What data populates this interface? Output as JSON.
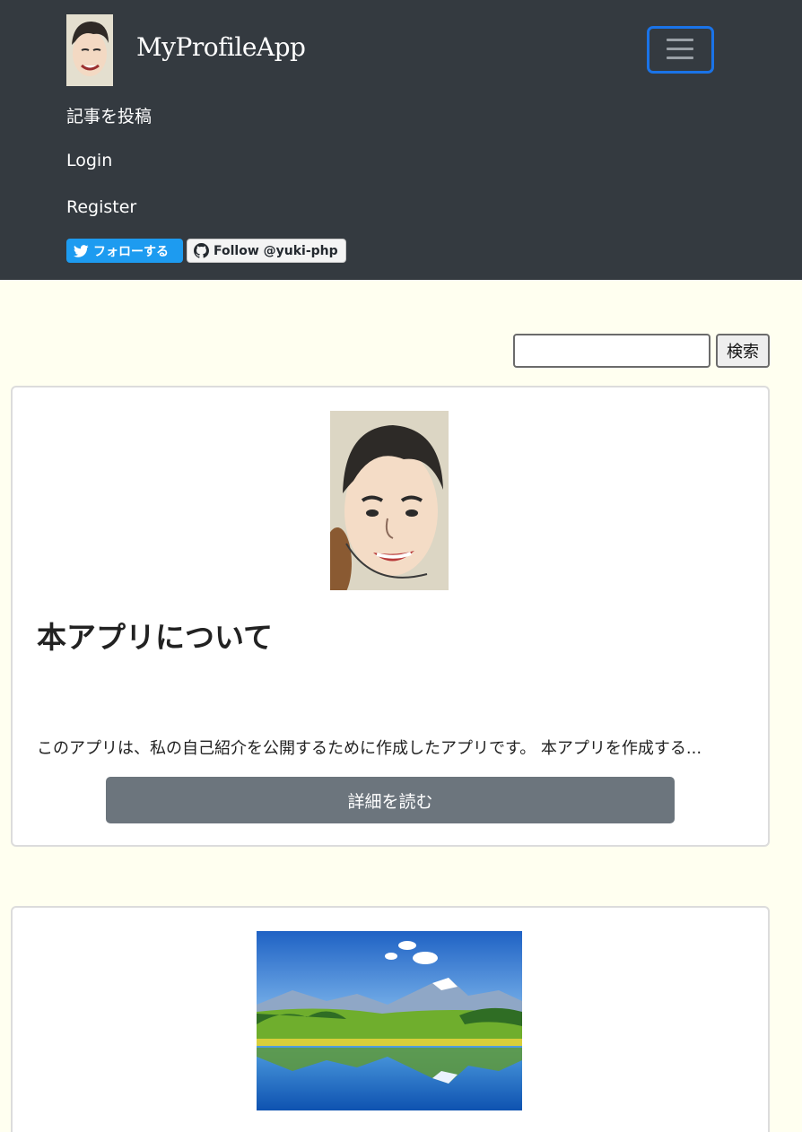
{
  "navbar": {
    "brand_name": "MyProfileApp",
    "links": [
      "記事を投稿",
      "Login",
      "Register"
    ],
    "twitter_follow_label": "フォローする",
    "github_follow_label": "Follow @yuki-php",
    "toggler_icon": "hamburger-icon",
    "background_color": "#343a40"
  },
  "search": {
    "input_value": "",
    "button_label": "検索"
  },
  "cards": [
    {
      "title": "本アプリについて",
      "excerpt": "このアプリは、私の自己紹介を公開するために作成したアプリです。 本アプリを作成する...",
      "button_label": "詳細を読む"
    }
  ],
  "colors": {
    "page_background": "#fffff0",
    "twitter_blue": "#1d9bf0",
    "button_gray": "#6c757d",
    "toggler_focus": "#1a73e8"
  }
}
